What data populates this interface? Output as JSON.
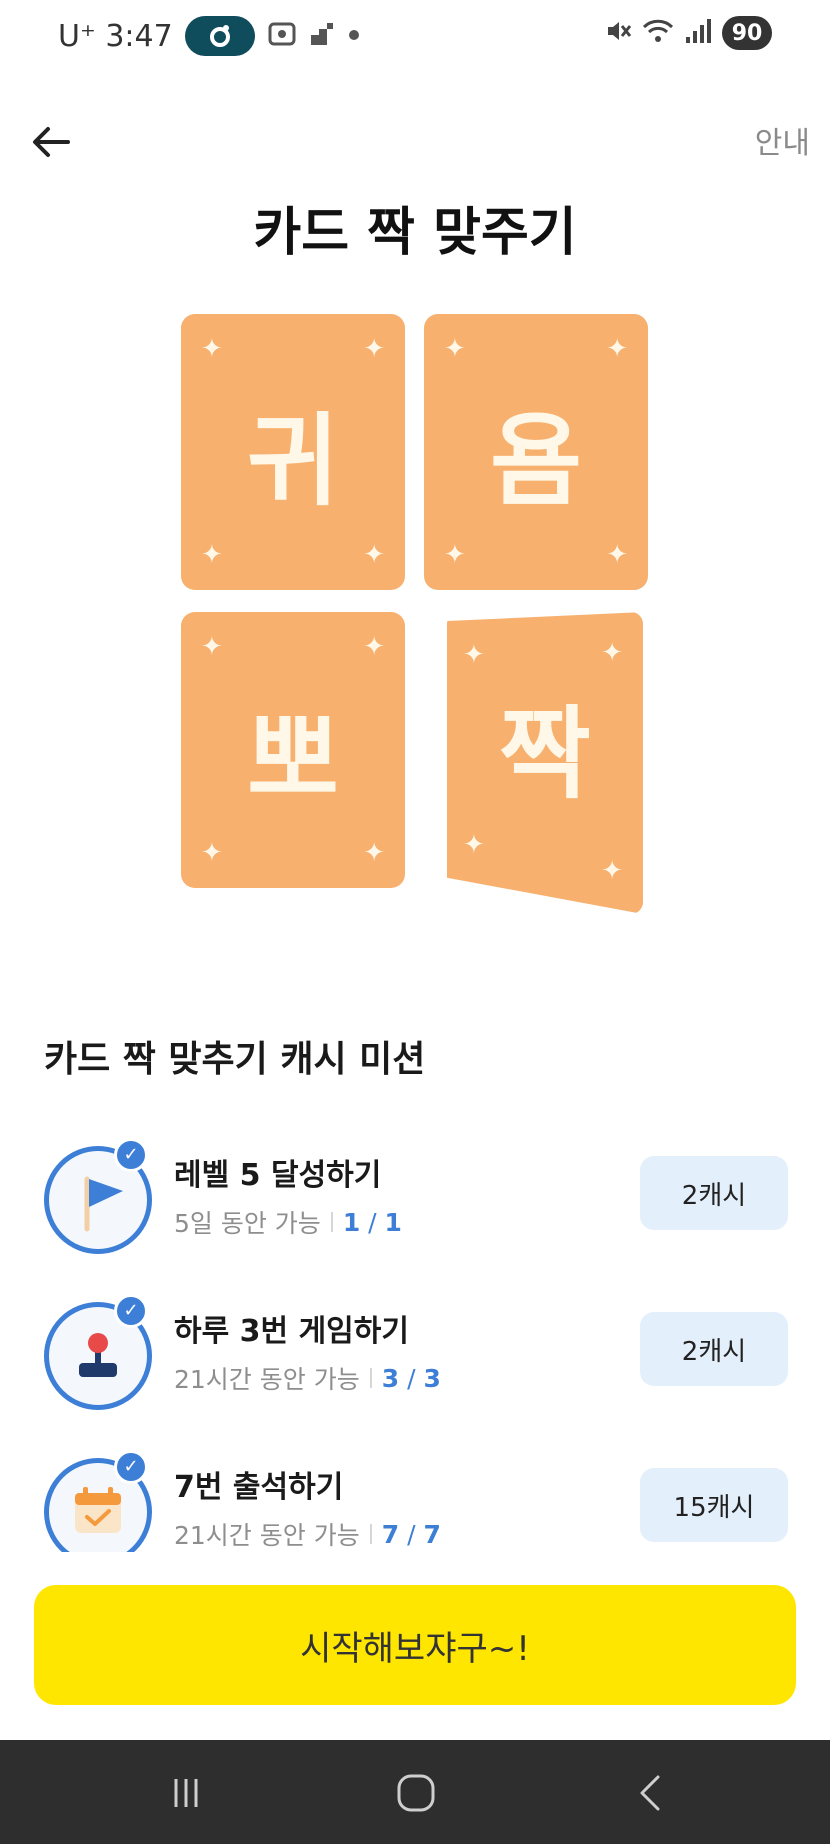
{
  "status_bar": {
    "carrier_time": "U⁺ 3:47",
    "battery": "90"
  },
  "header": {
    "guide_label": "안내",
    "title": "카드 짝 맞주기"
  },
  "cards": [
    "귀",
    "욤",
    "뽀",
    "짝"
  ],
  "missions": {
    "section_title": "카드 짝 맞추기 캐시 미션",
    "items": [
      {
        "title": "레벨 5 달성하기",
        "period": "5일 동안 가능",
        "current": "1",
        "total": "1",
        "reward": "2캐시"
      },
      {
        "title": "하루 3번 게임하기",
        "period": "21시간 동안 가능",
        "current": "3",
        "total": "3",
        "reward": "2캐시"
      },
      {
        "title": "7번 출석하기",
        "period": "21시간 동안 가능",
        "current": "7",
        "total": "7",
        "reward": "15캐시"
      }
    ]
  },
  "start_button": "시작해보쟈구~!",
  "colors": {
    "card": "#f7b06e",
    "accent_blue": "#3d7fd6",
    "start_yellow": "#ffe600",
    "reward_bg": "#e4effc"
  }
}
